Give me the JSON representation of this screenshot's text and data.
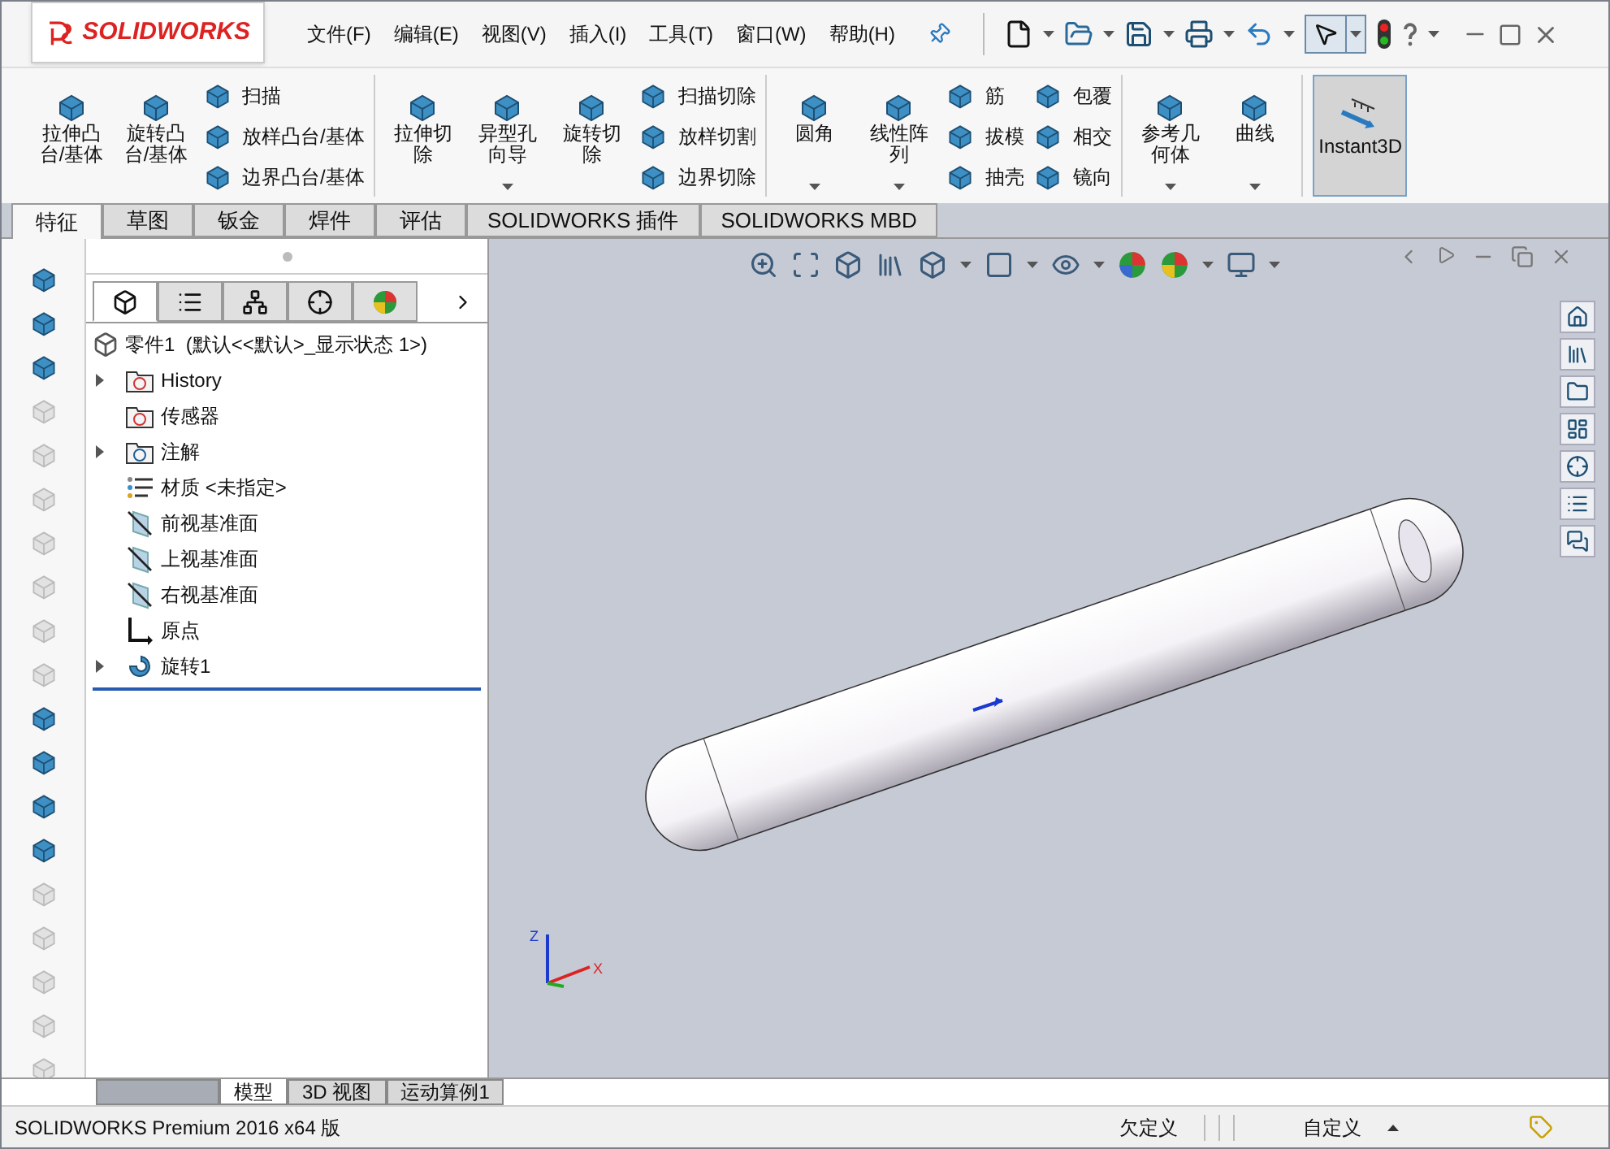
{
  "logo": "SOLIDWORKS",
  "menu": [
    "文件(F)",
    "编辑(E)",
    "视图(V)",
    "插入(I)",
    "工具(T)",
    "窗口(W)",
    "帮助(H)"
  ],
  "ribbon": [
    {
      "columns": [
        {
          "kind": "large",
          "label": "拉伸凸台/基体",
          "dropdown": false
        },
        {
          "kind": "large",
          "label": "旋转凸台/基体",
          "dropdown": false
        },
        {
          "kind": "stack",
          "items": [
            "扫描",
            "放样凸台/基体",
            "边界凸台/基体"
          ]
        }
      ]
    },
    {
      "columns": [
        {
          "kind": "large",
          "label": "拉伸切除",
          "dropdown": false
        },
        {
          "kind": "large",
          "label": "异型孔向导",
          "dropdown": true
        },
        {
          "kind": "large",
          "label": "旋转切除",
          "dropdown": false
        },
        {
          "kind": "stack",
          "items": [
            "扫描切除",
            "放样切割",
            "边界切除"
          ]
        }
      ]
    },
    {
      "columns": [
        {
          "kind": "large",
          "label": "圆角",
          "dropdown": true
        },
        {
          "kind": "large",
          "label": "线性阵列",
          "dropdown": true
        },
        {
          "kind": "stack",
          "items": [
            "筋",
            "拔模",
            "抽壳"
          ]
        },
        {
          "kind": "stack",
          "items": [
            "包覆",
            "相交",
            "镜向"
          ]
        }
      ]
    },
    {
      "columns": [
        {
          "kind": "large",
          "label": "参考几何体",
          "dropdown": true
        },
        {
          "kind": "large",
          "label": "曲线",
          "dropdown": true
        }
      ]
    },
    {
      "columns": [
        {
          "kind": "toggle",
          "label": "Instant3D",
          "selected": true
        }
      ]
    }
  ],
  "tabs": [
    {
      "label": "特征",
      "selected": true
    },
    {
      "label": "草图",
      "selected": false
    },
    {
      "label": "钣金",
      "selected": false
    },
    {
      "label": "焊件",
      "selected": false
    },
    {
      "label": "评估",
      "selected": false
    },
    {
      "label": "SOLIDWORKS 插件",
      "selected": false
    },
    {
      "label": "SOLIDWORKS MBD",
      "selected": false
    }
  ],
  "left_toolbar": [
    {
      "disabled": false
    },
    {
      "disabled": false
    },
    {
      "disabled": false
    },
    {
      "disabled": true
    },
    {
      "disabled": true
    },
    {
      "disabled": true
    },
    {
      "disabled": true
    },
    {
      "disabled": true
    },
    {
      "disabled": true
    },
    {
      "disabled": true
    },
    {
      "disabled": false
    },
    {
      "disabled": false
    },
    {
      "disabled": false
    },
    {
      "disabled": false
    },
    {
      "disabled": true
    },
    {
      "disabled": true
    },
    {
      "disabled": true
    },
    {
      "disabled": true
    },
    {
      "disabled": true
    }
  ],
  "panel_tabs": [
    {
      "kind": "tree",
      "selected": true
    },
    {
      "kind": "properties",
      "selected": false
    },
    {
      "kind": "config",
      "selected": false
    },
    {
      "kind": "dimxpert",
      "selected": false
    },
    {
      "kind": "display",
      "selected": false
    }
  ],
  "feature_tree": {
    "root": "零件1  (默认<<默认>_显示状态 1>)",
    "children": [
      {
        "label": "History",
        "kind": "history",
        "expandable": true
      },
      {
        "label": "传感器",
        "kind": "sensor",
        "expandable": false
      },
      {
        "label": "注解",
        "kind": "annotation",
        "expandable": true
      },
      {
        "label": "材质 <未指定>",
        "kind": "material",
        "expandable": false
      },
      {
        "label": "前视基准面",
        "kind": "plane",
        "expandable": false
      },
      {
        "label": "上视基准面",
        "kind": "plane",
        "expandable": false
      },
      {
        "label": "右视基准面",
        "kind": "plane",
        "expandable": false
      },
      {
        "label": "原点",
        "kind": "origin",
        "expandable": false
      },
      {
        "label": "旋转1",
        "kind": "revolve",
        "expandable": true
      }
    ]
  },
  "triad": {
    "z": "Z",
    "x": "X"
  },
  "bottom_tabs": [
    {
      "label": "模型",
      "selected": true
    },
    {
      "label": "3D 视图",
      "selected": false
    },
    {
      "label": "运动算例1",
      "selected": false
    }
  ],
  "status_bar": {
    "product": "SOLIDWORKS Premium 2016 x64 版",
    "state": "欠定义",
    "units": "自定义"
  }
}
